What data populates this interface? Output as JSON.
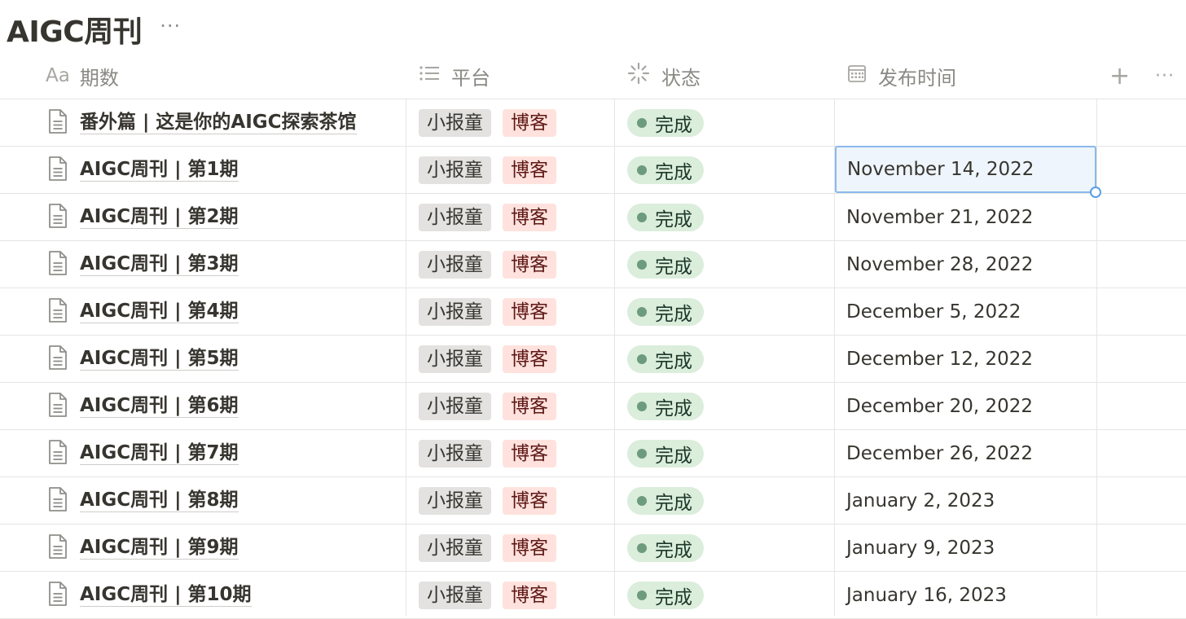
{
  "database": {
    "title": "AIGC周刊",
    "more_label": "···"
  },
  "columns": {
    "name": {
      "icon": "Aa",
      "label": "期数"
    },
    "platform": {
      "icon": "list-icon",
      "label": "平台"
    },
    "status": {
      "icon": "status-icon",
      "label": "状态"
    },
    "date": {
      "icon": "calendar-icon",
      "label": "发布时间"
    },
    "add_label": "+",
    "more_label": "···"
  },
  "colors": {
    "tag_gray": "#e3e2e0",
    "tag_red": "#ffe2dd",
    "status_green": "#dbeddb",
    "selection_blue": "#8bb9ec"
  },
  "rows": [
    {
      "name": "番外篇 | 这是你的AIGC探索茶馆",
      "platforms": [
        "小报童",
        "博客"
      ],
      "status": "完成",
      "date": ""
    },
    {
      "name": "AIGC周刊 | 第1期",
      "platforms": [
        "小报童",
        "博客"
      ],
      "status": "完成",
      "date": "November 14, 2022",
      "selected": true
    },
    {
      "name": "AIGC周刊 | 第2期",
      "platforms": [
        "小报童",
        "博客"
      ],
      "status": "完成",
      "date": "November 21, 2022"
    },
    {
      "name": "AIGC周刊 | 第3期",
      "platforms": [
        "小报童",
        "博客"
      ],
      "status": "完成",
      "date": "November 28, 2022"
    },
    {
      "name": "AIGC周刊 | 第4期",
      "platforms": [
        "小报童",
        "博客"
      ],
      "status": "完成",
      "date": "December 5, 2022"
    },
    {
      "name": "AIGC周刊 | 第5期",
      "platforms": [
        "小报童",
        "博客"
      ],
      "status": "完成",
      "date": "December 12, 2022"
    },
    {
      "name": "AIGC周刊 | 第6期",
      "platforms": [
        "小报童",
        "博客"
      ],
      "status": "完成",
      "date": "December 20, 2022"
    },
    {
      "name": "AIGC周刊 | 第7期",
      "platforms": [
        "小报童",
        "博客"
      ],
      "status": "完成",
      "date": "December 26, 2022"
    },
    {
      "name": "AIGC周刊 | 第8期",
      "platforms": [
        "小报童",
        "博客"
      ],
      "status": "完成",
      "date": "January 2, 2023"
    },
    {
      "name": "AIGC周刊 | 第9期",
      "platforms": [
        "小报童",
        "博客"
      ],
      "status": "完成",
      "date": "January 9, 2023"
    },
    {
      "name": "AIGC周刊 | 第10期",
      "platforms": [
        "小报童",
        "博客"
      ],
      "status": "完成",
      "date": "January 16, 2023"
    }
  ]
}
